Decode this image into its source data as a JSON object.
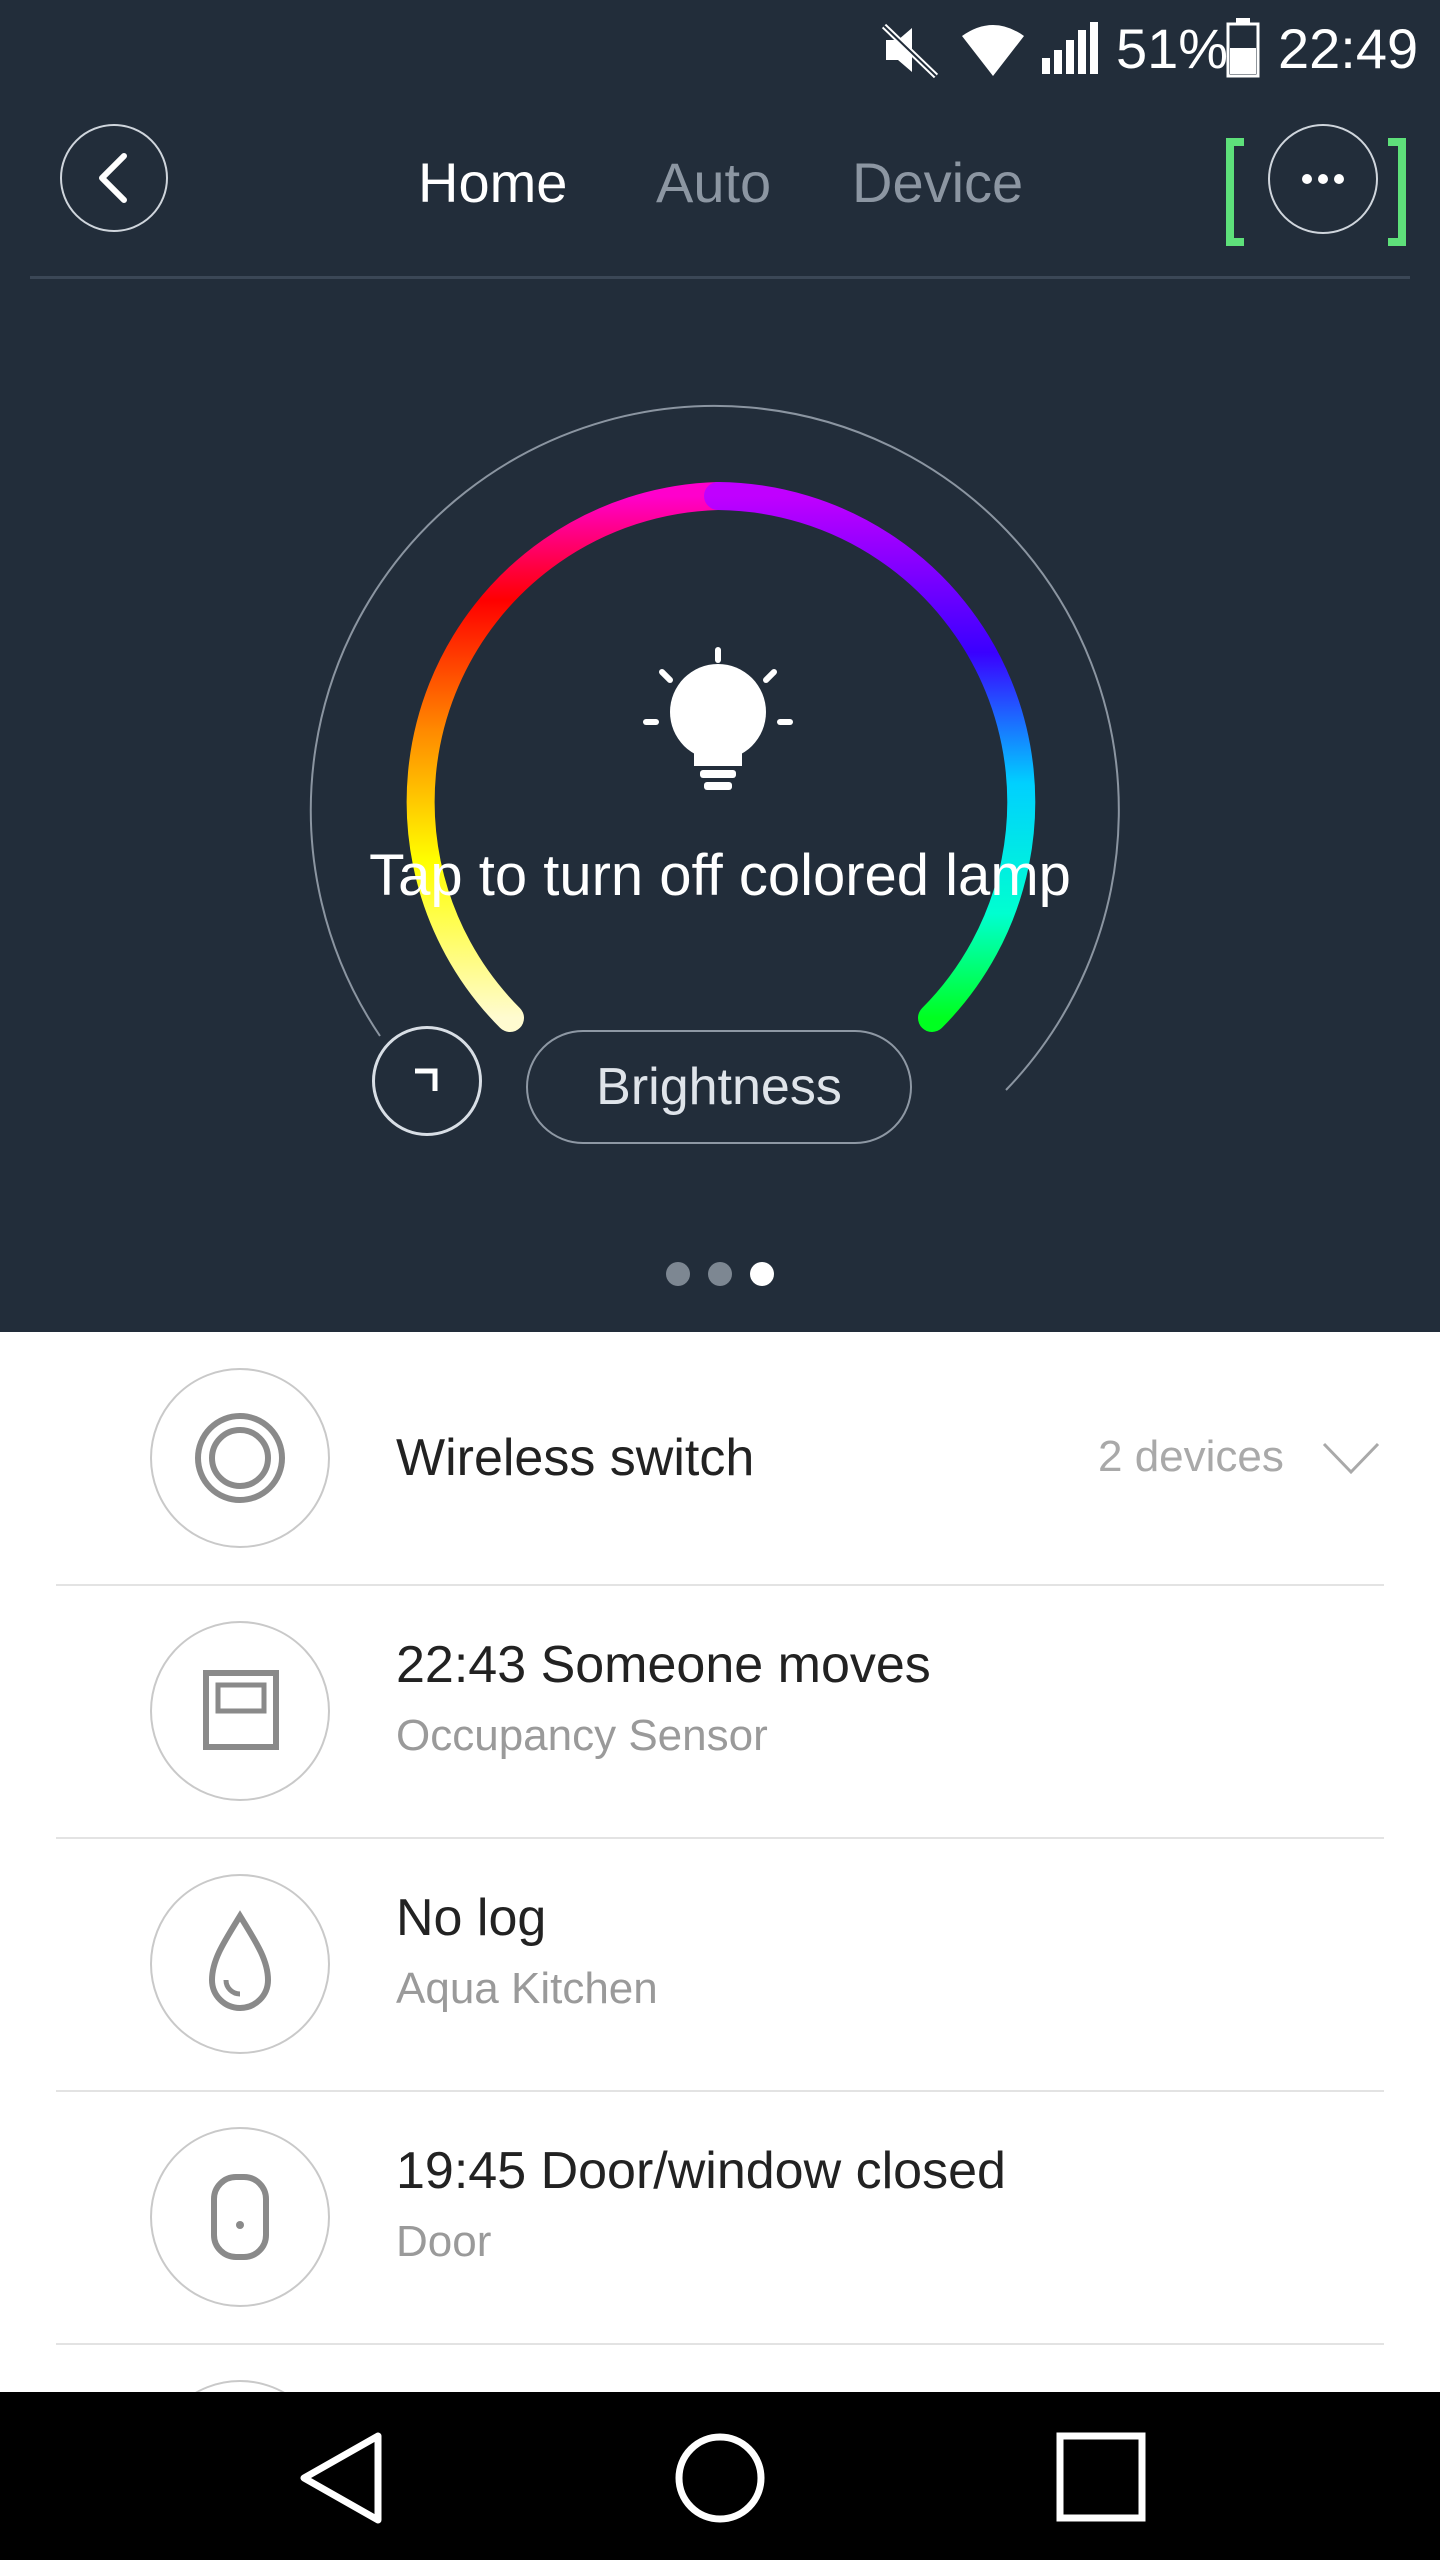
{
  "status_bar": {
    "battery_percent": "51%",
    "time": "22:49",
    "icons": [
      "mute-icon",
      "wifi-icon",
      "signal-icon",
      "battery-icon"
    ]
  },
  "header": {
    "tabs": [
      {
        "label": "Home",
        "active": true
      },
      {
        "label": "Auto",
        "active": false
      },
      {
        "label": "Device",
        "active": false
      }
    ]
  },
  "lamp": {
    "instruction": "Tap to turn off colored lamp",
    "brightness_button": "Brightness"
  },
  "pager": {
    "count": 3,
    "active_index": 2
  },
  "list": [
    {
      "title": "Wireless switch",
      "subtitle": "",
      "right_text": "2 devices",
      "icon": "wireless-switch-icon"
    },
    {
      "title": "22:43  Someone moves",
      "subtitle": "Occupancy Sensor",
      "icon": "occupancy-sensor-icon"
    },
    {
      "title": "No log",
      "subtitle": "Aqua Kitchen",
      "icon": "water-drop-icon"
    },
    {
      "title": "19:45  Door/window closed",
      "subtitle": "Door",
      "icon": "door-sensor-icon"
    }
  ],
  "colors": {
    "header_bg": "#222d3a",
    "accent_bracket": "#5ee07a",
    "list_bg": "#ffffff"
  }
}
